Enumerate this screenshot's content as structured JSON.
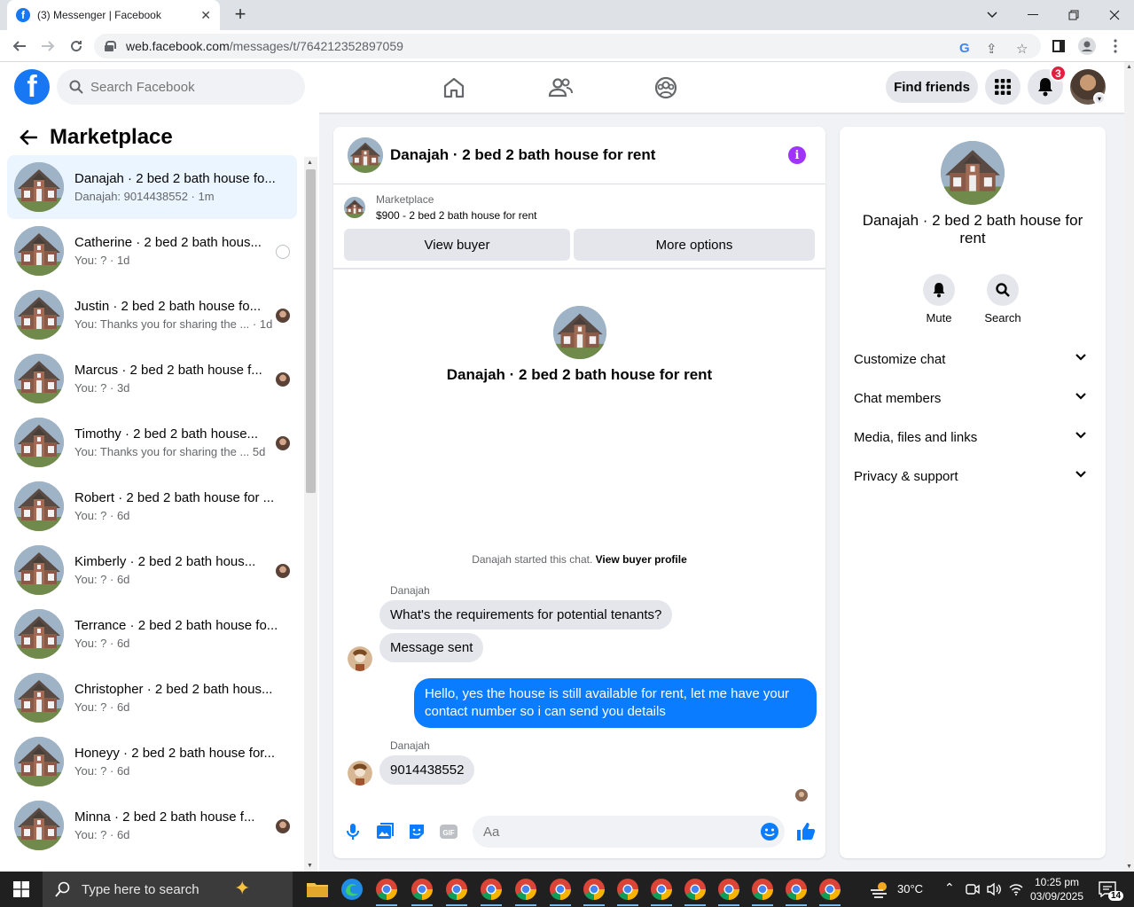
{
  "browser": {
    "tab_title": "(3) Messenger | Facebook",
    "url_domain": "web.facebook.com",
    "url_path": "/messages/t/764212352897059"
  },
  "fb": {
    "search_placeholder": "Search Facebook",
    "find_friends": "Find friends",
    "notification_count": "3",
    "brand_color": "#1877f2"
  },
  "sidebar": {
    "title": "Marketplace",
    "conversations": [
      {
        "name": "Danajah · 2 bed 2 bath house fo...",
        "sub": "Danajah: 9014438552 · 1m",
        "mini": ""
      },
      {
        "name": "Catherine · 2 bed 2 bath hous...",
        "sub": "You: ? · 1d",
        "mini": "seen"
      },
      {
        "name": "Justin · 2 bed 2 bath house fo...",
        "sub": "You: Thanks you for sharing the ... · 1d",
        "mini": "avatar"
      },
      {
        "name": "Marcus · 2 bed 2 bath house f...",
        "sub": "You: ? · 3d",
        "mini": "avatar"
      },
      {
        "name": "Timothy · 2 bed 2 bath house...",
        "sub": "You: Thanks you for sharing the ...   5d",
        "mini": "avatar"
      },
      {
        "name": "Robert · 2 bed 2 bath house for ...",
        "sub": "You: ? · 6d",
        "mini": ""
      },
      {
        "name": "Kimberly · 2 bed 2 bath hous...",
        "sub": "You: ? · 6d",
        "mini": "avatar"
      },
      {
        "name": "Terrance · 2 bed 2 bath house fo...",
        "sub": "You: ? · 6d",
        "mini": ""
      },
      {
        "name": "Christopher · 2 bed 2 bath hous...",
        "sub": "You: ? · 6d",
        "mini": ""
      },
      {
        "name": "Honeyy · 2 bed 2 bath house for...",
        "sub": "You: ? · 6d",
        "mini": ""
      },
      {
        "name": "Minna · 2 bed 2 bath house f...",
        "sub": "You: ? · 6d",
        "mini": "avatar"
      }
    ]
  },
  "chat": {
    "title": "Danajah · 2 bed 2 bath house for rent",
    "marketplace_label": "Marketplace",
    "listing": "$900 - 2 bed 2 bath house for rent",
    "view_buyer": "View buyer",
    "more_options": "More options",
    "intro_name": "Danajah · 2 bed 2 bath house for rent",
    "started_text": "Danajah started this chat.",
    "view_buyer_profile": "View buyer profile",
    "sender": "Danajah",
    "msg1": "What's the requirements for potential tenants?",
    "msg2": "Message sent",
    "msg3": "Hello, yes the house is still available for rent, let me have your contact number so i can send you  details",
    "msg4": "9014438552",
    "composer_placeholder": "Aa",
    "outgoing_color": "#0a7cff"
  },
  "rpanel": {
    "name": "Danajah · 2 bed 2 bath house for rent",
    "mute": "Mute",
    "search": "Search",
    "rows": [
      "Customize chat",
      "Chat members",
      "Media, files and links",
      "Privacy & support"
    ]
  },
  "taskbar": {
    "search_placeholder": "Type here to search",
    "temp": "30°C",
    "time": "10:25 pm",
    "date": "03/09/2025",
    "notif": "14"
  }
}
